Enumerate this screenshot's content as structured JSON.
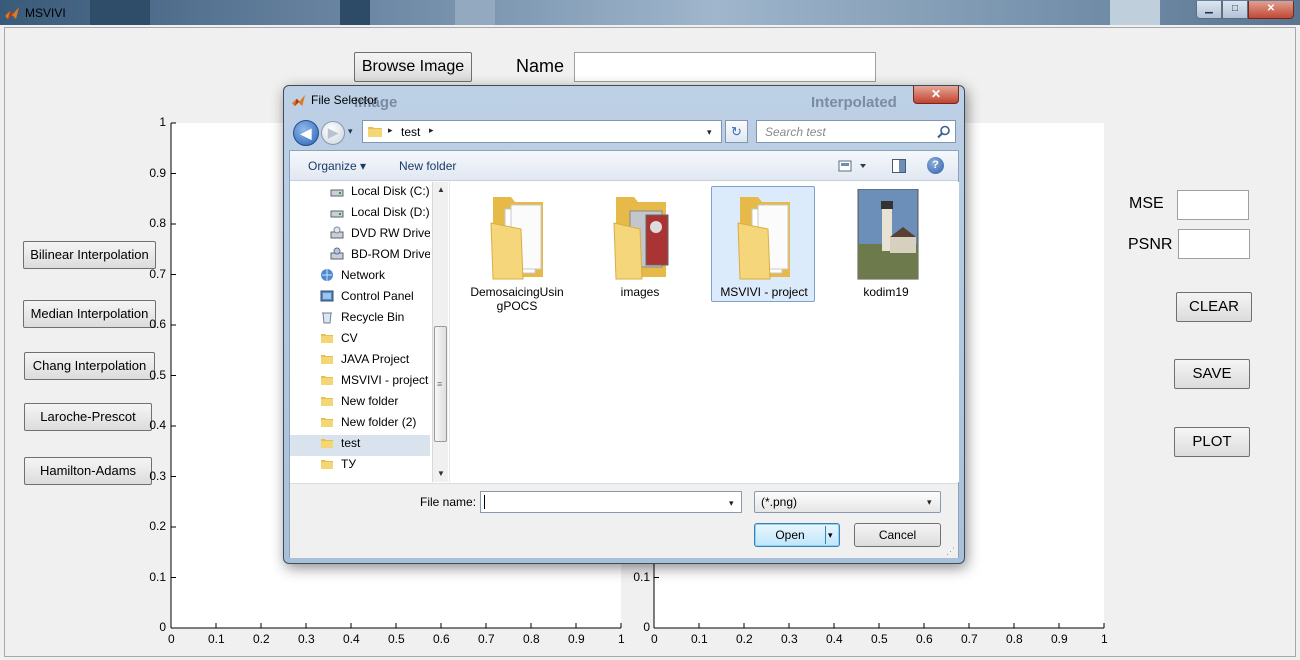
{
  "window": {
    "title": "MSVIVI",
    "minimize": "▁",
    "maximize": "□",
    "close": "✕"
  },
  "top": {
    "browse_label": "Browse Image",
    "name_label": "Name",
    "name_value": ""
  },
  "algorithms": [
    "Bilinear Interpolation",
    "Median Interpolation",
    "Chang Interpolation",
    "Laroche-Prescot",
    "Hamilton-Adams"
  ],
  "metrics": {
    "mse_label": "MSE",
    "mse_value": "",
    "psnr_label": "PSNR",
    "psnr_value": ""
  },
  "actions": {
    "clear": "CLEAR",
    "save": "SAVE",
    "plot": "PLOT"
  },
  "axes": {
    "left_y_ticks": [
      "1",
      "0.9",
      "0.8",
      "0.7",
      "0.6",
      "0.5",
      "0.4",
      "0.3",
      "0.2",
      "0.1",
      "0"
    ],
    "left_x_ticks": [
      "0",
      "0.1",
      "0.2",
      "0.3",
      "0.4",
      "0.5",
      "0.6",
      "0.7",
      "0.8",
      "0.9",
      "1"
    ],
    "right_y_ticks_visible": [
      "0.1",
      "0"
    ],
    "right_x_ticks": [
      "0",
      "0.1",
      "0.2",
      "0.3",
      "0.4",
      "0.5",
      "0.6",
      "0.7",
      "0.8",
      "0.9",
      "1"
    ],
    "behind_dialog_titles": [
      "Image",
      "Interpolated"
    ]
  },
  "dialog": {
    "title": "File Selector",
    "close": "✕",
    "address": {
      "path": "test",
      "sep": "▸",
      "dropdown": "▾"
    },
    "back": "◀",
    "forward": "▶",
    "history": "▾",
    "refresh": "↻",
    "search": {
      "placeholder": "Search test"
    },
    "toolbar": {
      "organize": "Organize ▾",
      "new_folder": "New folder",
      "help": "?"
    },
    "nav_items": [
      {
        "label": "Local Disk (C:)",
        "icon": "local-disk-icon"
      },
      {
        "label": "Local Disk (D:)",
        "icon": "local-disk-icon"
      },
      {
        "label": "DVD RW Drive (",
        "icon": "dvd-drive-icon"
      },
      {
        "label": "BD-ROM Drive",
        "icon": "bd-rom-drive-icon"
      },
      {
        "label": "Network",
        "icon": "network-icon"
      },
      {
        "label": "Control Panel",
        "icon": "control-panel-icon"
      },
      {
        "label": "Recycle Bin",
        "icon": "recycle-bin-icon"
      },
      {
        "label": "CV",
        "icon": "folder-icon"
      },
      {
        "label": "JAVA Project",
        "icon": "folder-icon"
      },
      {
        "label": "MSVIVI - project",
        "icon": "folder-icon"
      },
      {
        "label": "New folder",
        "icon": "folder-icon"
      },
      {
        "label": "New folder (2)",
        "icon": "folder-icon"
      },
      {
        "label": "test",
        "icon": "folder-icon",
        "selected": true
      },
      {
        "label": "ТУ",
        "icon": "folder-icon"
      }
    ],
    "scroll_up": "▲",
    "scroll_down": "▼",
    "scroll_grip": "≡",
    "files": [
      {
        "label": "DemosaicingUsin gPOCS",
        "icon": "folder-documents-icon"
      },
      {
        "label": "images",
        "icon": "folder-images-icon"
      },
      {
        "label": "MSVIVI - project",
        "icon": "folder-documents-icon",
        "selected": true
      },
      {
        "label": "kodim19",
        "icon": "image-file-icon"
      }
    ],
    "filename": {
      "label": "File name:",
      "value": "",
      "dropdown": "▾"
    },
    "filetype": {
      "value": "(*.png)",
      "arrow": "▾"
    },
    "open": "Open",
    "open_arrow": "▾",
    "cancel": "Cancel",
    "resize_grip": "⋰"
  },
  "colors": {
    "accent": "#3c7fb1",
    "folder": "#f3d071",
    "selection": "#dcebfc"
  }
}
